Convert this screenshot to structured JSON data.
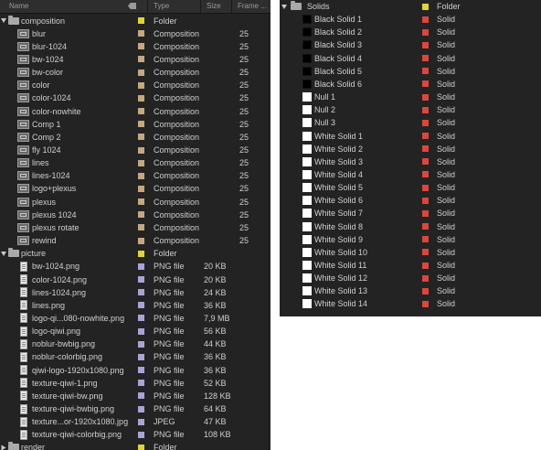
{
  "header": {
    "name": "Name",
    "type": "Type",
    "size": "Size",
    "frame": "Frame ...",
    "label_icon": "tag-icon"
  },
  "left_rows": [
    {
      "kind": "folder",
      "name": "composition",
      "color": "#e2d23a",
      "type": "Folder",
      "size": "",
      "frame": ""
    },
    {
      "kind": "comp",
      "name": "blur",
      "color": "#c4a882",
      "type": "Composition",
      "size": "",
      "frame": "25"
    },
    {
      "kind": "comp",
      "name": "blur-1024",
      "color": "#c4a882",
      "type": "Composition",
      "size": "",
      "frame": "25"
    },
    {
      "kind": "comp",
      "name": "bw-1024",
      "color": "#c4a882",
      "type": "Composition",
      "size": "",
      "frame": "25"
    },
    {
      "kind": "comp",
      "name": "bw-color",
      "color": "#c4a882",
      "type": "Composition",
      "size": "",
      "frame": "25"
    },
    {
      "kind": "comp",
      "name": "color",
      "color": "#c4a882",
      "type": "Composition",
      "size": "",
      "frame": "25"
    },
    {
      "kind": "comp",
      "name": "color-1024",
      "color": "#c4a882",
      "type": "Composition",
      "size": "",
      "frame": "25"
    },
    {
      "kind": "comp",
      "name": "color-nowhite",
      "color": "#c4a882",
      "type": "Composition",
      "size": "",
      "frame": "25"
    },
    {
      "kind": "comp",
      "name": "Comp 1",
      "color": "#c4a882",
      "type": "Composition",
      "size": "",
      "frame": "25"
    },
    {
      "kind": "comp",
      "name": "Comp 2",
      "color": "#c4a882",
      "type": "Composition",
      "size": "",
      "frame": "25"
    },
    {
      "kind": "comp",
      "name": "fly 1024",
      "color": "#c4a882",
      "type": "Composition",
      "size": "",
      "frame": "25"
    },
    {
      "kind": "comp",
      "name": "lines",
      "color": "#c4a882",
      "type": "Composition",
      "size": "",
      "frame": "25"
    },
    {
      "kind": "comp",
      "name": "lines-1024",
      "color": "#c4a882",
      "type": "Composition",
      "size": "",
      "frame": "25"
    },
    {
      "kind": "comp",
      "name": "logo+plexus",
      "color": "#c4a882",
      "type": "Composition",
      "size": "",
      "frame": "25"
    },
    {
      "kind": "comp",
      "name": "plexus",
      "color": "#c4a882",
      "type": "Composition",
      "size": "",
      "frame": "25"
    },
    {
      "kind": "comp",
      "name": "plexus 1024",
      "color": "#c4a882",
      "type": "Composition",
      "size": "",
      "frame": "25"
    },
    {
      "kind": "comp",
      "name": "plexus rotate",
      "color": "#c4a882",
      "type": "Composition",
      "size": "",
      "frame": "25"
    },
    {
      "kind": "comp",
      "name": "rewind",
      "color": "#c4a882",
      "type": "Composition",
      "size": "",
      "frame": "25"
    },
    {
      "kind": "folder",
      "name": "picture",
      "color": "#e2d23a",
      "type": "Folder",
      "size": "",
      "frame": ""
    },
    {
      "kind": "file",
      "name": "bw-1024.png",
      "color": "#a9a3d6",
      "type": "PNG file",
      "size": "20 KB",
      "frame": ""
    },
    {
      "kind": "file",
      "name": "color-1024.png",
      "color": "#a9a3d6",
      "type": "PNG file",
      "size": "20 KB",
      "frame": ""
    },
    {
      "kind": "file",
      "name": "lines-1024.png",
      "color": "#a9a3d6",
      "type": "PNG file",
      "size": "24 KB",
      "frame": ""
    },
    {
      "kind": "file",
      "name": "lines.png",
      "color": "#a9a3d6",
      "type": "PNG file",
      "size": "36 KB",
      "frame": ""
    },
    {
      "kind": "file",
      "name": "logo-qi...080-nowhite.png",
      "color": "#a9a3d6",
      "type": "PNG file",
      "size": "7,9 MB",
      "frame": ""
    },
    {
      "kind": "file",
      "name": "logo-qiwi.png",
      "color": "#a9a3d6",
      "type": "PNG file",
      "size": "56 KB",
      "frame": ""
    },
    {
      "kind": "file",
      "name": "noblur-bwbig.png",
      "color": "#a9a3d6",
      "type": "PNG file",
      "size": "44 KB",
      "frame": ""
    },
    {
      "kind": "file",
      "name": "noblur-colorbig.png",
      "color": "#a9a3d6",
      "type": "PNG file",
      "size": "36 KB",
      "frame": ""
    },
    {
      "kind": "file",
      "name": "qiwi-logo-1920x1080.png",
      "color": "#a9a3d6",
      "type": "PNG file",
      "size": "36 KB",
      "frame": ""
    },
    {
      "kind": "file",
      "name": "texture-qiwi-1.png",
      "color": "#a9a3d6",
      "type": "PNG file",
      "size": "52 KB",
      "frame": ""
    },
    {
      "kind": "file",
      "name": "texture-qiwi-bw.png",
      "color": "#a9a3d6",
      "type": "PNG file",
      "size": "128 KB",
      "frame": ""
    },
    {
      "kind": "file",
      "name": "texture-qiwi-bwbig.png",
      "color": "#a9a3d6",
      "type": "PNG file",
      "size": "64 KB",
      "frame": ""
    },
    {
      "kind": "file",
      "name": "texture...or-1920x1080.jpg",
      "color": "#a9a3d6",
      "type": "JPEG",
      "size": "47 KB",
      "frame": ""
    },
    {
      "kind": "file",
      "name": "texture-qiwi-colorbig.png",
      "color": "#a9a3d6",
      "type": "PNG file",
      "size": "108 KB",
      "frame": ""
    },
    {
      "kind": "folder-closed",
      "name": "render",
      "color": "#e2d23a",
      "type": "Folder",
      "size": "",
      "frame": ""
    }
  ],
  "right_rows": [
    {
      "kind": "folder",
      "name": "Solids",
      "color": "#e2d23a",
      "type": "Folder",
      "solid": ""
    },
    {
      "kind": "solid",
      "name": "Black Solid 1",
      "color": "#d9473e",
      "type": "Solid",
      "solid": "#000000"
    },
    {
      "kind": "solid",
      "name": "Black Solid 2",
      "color": "#d9473e",
      "type": "Solid",
      "solid": "#000000"
    },
    {
      "kind": "solid",
      "name": "Black Solid 3",
      "color": "#d9473e",
      "type": "Solid",
      "solid": "#000000"
    },
    {
      "kind": "solid",
      "name": "Black Solid 4",
      "color": "#d9473e",
      "type": "Solid",
      "solid": "#000000"
    },
    {
      "kind": "solid",
      "name": "Black Solid 5",
      "color": "#d9473e",
      "type": "Solid",
      "solid": "#000000"
    },
    {
      "kind": "solid",
      "name": "Black Solid 6",
      "color": "#d9473e",
      "type": "Solid",
      "solid": "#000000"
    },
    {
      "kind": "solid",
      "name": "Null 1",
      "color": "#d9473e",
      "type": "Solid",
      "solid": "#ffffff"
    },
    {
      "kind": "solid",
      "name": "Null 2",
      "color": "#d9473e",
      "type": "Solid",
      "solid": "#ffffff"
    },
    {
      "kind": "solid",
      "name": "Null 3",
      "color": "#d9473e",
      "type": "Solid",
      "solid": "#ffffff"
    },
    {
      "kind": "solid",
      "name": "White Solid 1",
      "color": "#d9473e",
      "type": "Solid",
      "solid": "#ffffff"
    },
    {
      "kind": "solid",
      "name": "White Solid 2",
      "color": "#d9473e",
      "type": "Solid",
      "solid": "#ffffff"
    },
    {
      "kind": "solid",
      "name": "White Solid 3",
      "color": "#d9473e",
      "type": "Solid",
      "solid": "#ffffff"
    },
    {
      "kind": "solid",
      "name": "White Solid 4",
      "color": "#d9473e",
      "type": "Solid",
      "solid": "#ffffff"
    },
    {
      "kind": "solid",
      "name": "White Solid 5",
      "color": "#d9473e",
      "type": "Solid",
      "solid": "#ffffff"
    },
    {
      "kind": "solid",
      "name": "White Solid 6",
      "color": "#d9473e",
      "type": "Solid",
      "solid": "#ffffff"
    },
    {
      "kind": "solid",
      "name": "White Solid 7",
      "color": "#d9473e",
      "type": "Solid",
      "solid": "#ffffff"
    },
    {
      "kind": "solid",
      "name": "White Solid 8",
      "color": "#d9473e",
      "type": "Solid",
      "solid": "#ffffff"
    },
    {
      "kind": "solid",
      "name": "White Solid 9",
      "color": "#d9473e",
      "type": "Solid",
      "solid": "#ffffff"
    },
    {
      "kind": "solid",
      "name": "White Solid 10",
      "color": "#d9473e",
      "type": "Solid",
      "solid": "#ffffff"
    },
    {
      "kind": "solid",
      "name": "White Solid 11",
      "color": "#d9473e",
      "type": "Solid",
      "solid": "#ffffff"
    },
    {
      "kind": "solid",
      "name": "White Solid 12",
      "color": "#d9473e",
      "type": "Solid",
      "solid": "#ffffff"
    },
    {
      "kind": "solid",
      "name": "White Solid 13",
      "color": "#d9473e",
      "type": "Solid",
      "solid": "#ffffff"
    },
    {
      "kind": "solid",
      "name": "White Solid 14",
      "color": "#d9473e",
      "type": "Solid",
      "solid": "#ffffff"
    }
  ]
}
